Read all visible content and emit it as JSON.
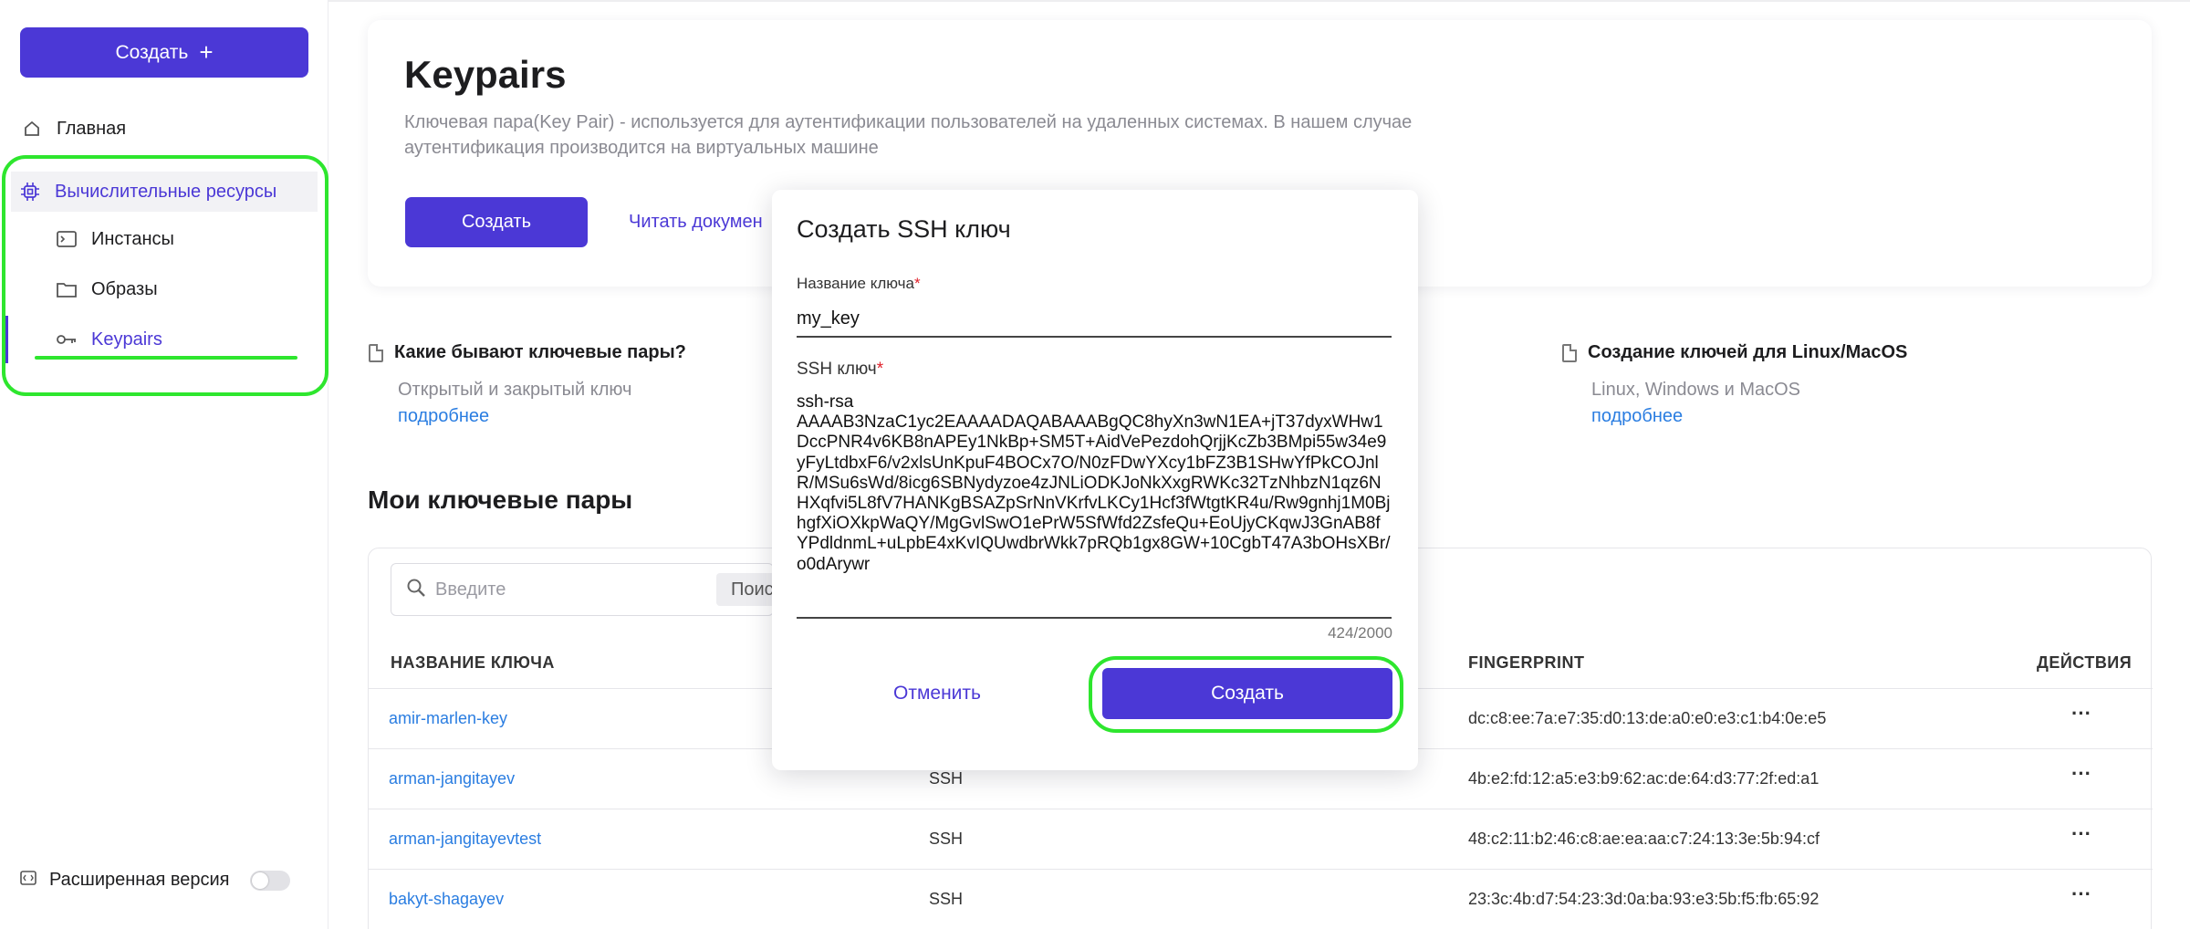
{
  "sidebar": {
    "create_label": "Создать",
    "home_label": "Главная",
    "compute_label": "Вычислительные ресурсы",
    "instances_label": "Инстансы",
    "images_label": "Образы",
    "keypairs_label": "Keypairs",
    "extended_label": "Расширенная версия",
    "extended_enabled": false
  },
  "hero": {
    "title": "Keypairs",
    "description": "Ключевая пара(Key Pair) - используется для аутентификации пользователей на удаленных системах. В нашем случае аутентификация производится на виртуальных машине",
    "create_label": "Создать",
    "docs_label": "Читать докумен"
  },
  "info": [
    {
      "title": "Какие бывают ключевые пары?",
      "desc": "Открытый и закрытый ключ",
      "link": "подробнее"
    },
    {
      "title": "Создание ключей для Linux/MacOS",
      "desc": "Linux, Windows и MacOS",
      "link": "подробнее"
    }
  ],
  "my_keys": {
    "title": "Мои ключевые пары",
    "search_placeholder": "Введите",
    "search_button": "Поиск",
    "columns": {
      "name": "НАЗВАНИЕ КЛЮЧА",
      "fingerprint": "FINGERPRINT",
      "actions": "ДЕЙСТВИЯ"
    },
    "rows": [
      {
        "name": "amir-marlen-key",
        "type": "",
        "fingerprint": "dc:c8:ee:7a:e7:35:d0:13:de:a0:e0:e3:c1:b4:0e:e5"
      },
      {
        "name": "arman-jangitayev",
        "type": "SSH",
        "fingerprint": "4b:e2:fd:12:a5:e3:b9:62:ac:de:64:d3:77:2f:ed:a1"
      },
      {
        "name": "arman-jangitayevtest",
        "type": "SSH",
        "fingerprint": "48:c2:11:b2:46:c8:ae:ea:aa:c7:24:13:3e:5b:94:cf"
      },
      {
        "name": "bakyt-shagayev",
        "type": "SSH",
        "fingerprint": "23:3c:4b:d7:54:23:3d:0a:ba:93:e3:5b:f5:fb:65:92"
      }
    ],
    "actions_glyph": "···"
  },
  "modal": {
    "title": "Создать SSH ключ",
    "name_label": "Название ключа",
    "name_value": "my_key",
    "ssh_label": "SSH ключ",
    "required_mark": "*",
    "ssh_value": "ssh-rsa\nAAAAB3NzaC1yc2EAAAADAQABAAABgQC8hyXn3wN1EA+jT37dyxWHw1DccPNR4v6KB8nAPEy1NkBp+SM5T+AidVePezdohQrjjKcZb3BMpi55w34e9yFyLtdbxF6/v2xlsUnKpuF4BOCx7O/N0zFDwYXcy1bFZ3B1SHwYfPkCOJnlR/MSu6sWd/8icg6SBNydyzoe4zJNLiODKJoNkXxgRWKc32TzNhbzN1qz6NHXqfvi5L8fV7HANKgBSAZpSrNnVKrfvLKCy1Hcf3fWtgtKR4u/Rw9gnhj1M0BjhgfXiOXkpWaQY/MgGvlSwO1ePrW5SfWfd2ZsfeQu+EoUjyCKqwJ3GnAB8fYPdldnmL+uLpbE4xKvIQUwdbrWkk7pRQb1gx8GW+10CgbT47A3bOHsXBr/o0dArywr",
    "counter": "424/2000",
    "cancel_label": "Отменить",
    "submit_label": "Создать"
  }
}
